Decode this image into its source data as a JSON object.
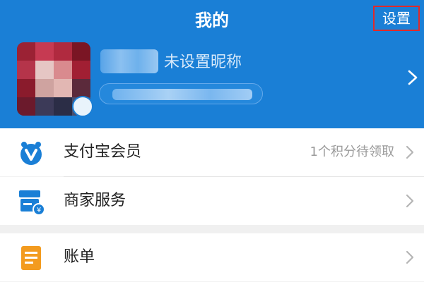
{
  "header": {
    "title": "我的",
    "settings_label": "设置",
    "nickname_placeholder": "未设置昵称",
    "background_color": "#1a7fd6",
    "settings_highlight_color": "#e12a2a"
  },
  "menu": {
    "items": [
      {
        "label": "支付宝会员",
        "hint": "1个积分待领取",
        "icon": "alipay-member-icon"
      },
      {
        "label": "商家服务",
        "hint": "",
        "icon": "merchant-service-icon"
      },
      {
        "label": "账单",
        "hint": "",
        "icon": "bill-icon"
      }
    ]
  }
}
